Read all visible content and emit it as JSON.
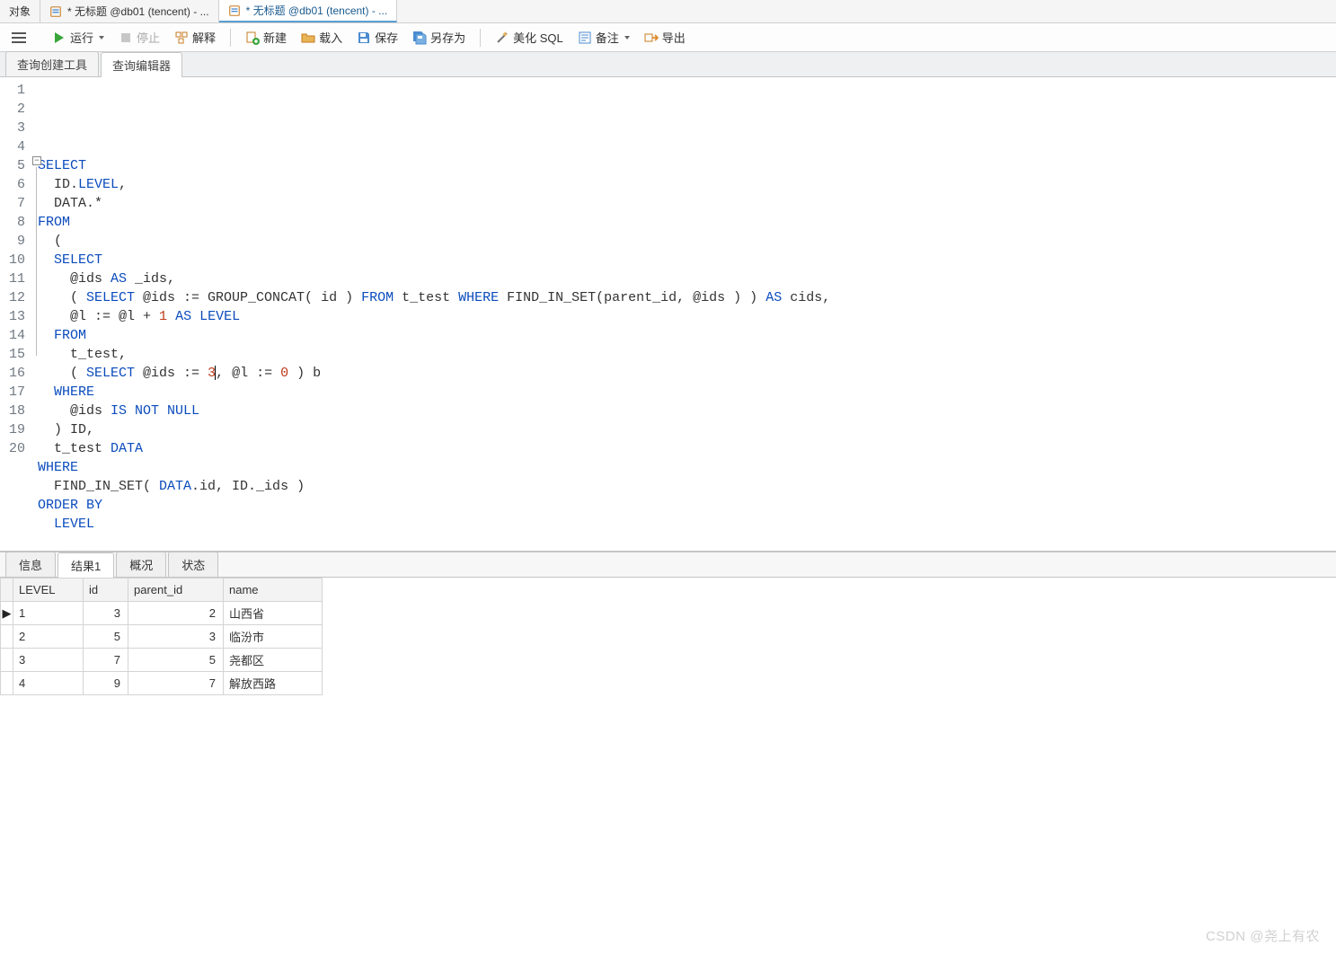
{
  "top_tabs": {
    "objects": "对象",
    "tab1": "* 无标题 @db01 (tencent) - ...",
    "tab2": "* 无标题 @db01 (tencent) - ..."
  },
  "toolbar": {
    "run": "运行",
    "stop": "停止",
    "explain": "解释",
    "new": "新建",
    "load": "载入",
    "save": "保存",
    "saveAs": "另存为",
    "beautify": "美化 SQL",
    "note": "备注",
    "export": "导出"
  },
  "sub_tabs": {
    "builder": "查询创建工具",
    "editor": "查询编辑器"
  },
  "editor": {
    "line_count": 20,
    "tokens": [
      [
        [
          "SELECT",
          "kw"
        ]
      ],
      [
        [
          "  ID",
          "ident"
        ],
        [
          ".",
          "ident"
        ],
        [
          "LEVEL",
          "kw"
        ],
        [
          ",",
          "ident"
        ]
      ],
      [
        [
          "  DATA",
          "ident"
        ],
        [
          ".*",
          "ident"
        ]
      ],
      [
        [
          "FROM",
          "kw"
        ]
      ],
      [
        [
          "  (",
          "ident"
        ]
      ],
      [
        [
          "  SELECT",
          "kw"
        ]
      ],
      [
        [
          "    @ids ",
          "ident"
        ],
        [
          "AS",
          "kw"
        ],
        [
          " _ids,",
          "ident"
        ]
      ],
      [
        [
          "    ( ",
          "ident"
        ],
        [
          "SELECT",
          "kw"
        ],
        [
          " @ids := GROUP_CONCAT( id ) ",
          "ident"
        ],
        [
          "FROM",
          "kw"
        ],
        [
          " t_test ",
          "ident"
        ],
        [
          "WHERE",
          "kw"
        ],
        [
          " FIND_IN_SET(parent_id, @ids ) ) ",
          "ident"
        ],
        [
          "AS",
          "kw"
        ],
        [
          " cids,",
          "ident"
        ]
      ],
      [
        [
          "    @l := @l + ",
          "ident"
        ],
        [
          "1",
          "num"
        ],
        [
          " ",
          "ident"
        ],
        [
          "AS",
          "kw"
        ],
        [
          " ",
          "ident"
        ],
        [
          "LEVEL",
          "kw"
        ]
      ],
      [
        [
          "  FROM",
          "kw"
        ]
      ],
      [
        [
          "    t_test,",
          "ident"
        ]
      ],
      [
        [
          "    ( ",
          "ident"
        ],
        [
          "SELECT",
          "kw"
        ],
        [
          " @ids := ",
          "ident"
        ],
        [
          "3",
          "num"
        ],
        [
          ", @l := ",
          "ident"
        ],
        [
          "0",
          "num"
        ],
        [
          " ) b",
          "ident"
        ]
      ],
      [
        [
          "  WHERE",
          "kw"
        ]
      ],
      [
        [
          "    @ids ",
          "ident"
        ],
        [
          "IS NOT NULL",
          "kw"
        ]
      ],
      [
        [
          "  ) ID,",
          "ident"
        ]
      ],
      [
        [
          "  t_test ",
          "ident"
        ],
        [
          "DATA",
          "kw"
        ]
      ],
      [
        [
          "WHERE",
          "kw"
        ]
      ],
      [
        [
          "  FIND_IN_SET( ",
          "ident"
        ],
        [
          "DATA",
          "kw"
        ],
        [
          ".id, ID._ids )",
          "ident"
        ]
      ],
      [
        [
          "ORDER BY",
          "kw"
        ]
      ],
      [
        [
          "  LEVEL",
          "kw"
        ]
      ]
    ]
  },
  "result_tabs": {
    "info": "信息",
    "result1": "结果1",
    "summary": "概况",
    "status": "状态"
  },
  "result_grid": {
    "columns": [
      "LEVEL",
      "id",
      "parent_id",
      "name"
    ],
    "rows": [
      {
        "LEVEL": "1",
        "id": "3",
        "parent_id": "2",
        "name": "山西省"
      },
      {
        "LEVEL": "2",
        "id": "5",
        "parent_id": "3",
        "name": "临汾市"
      },
      {
        "LEVEL": "3",
        "id": "7",
        "parent_id": "5",
        "name": "尧都区"
      },
      {
        "LEVEL": "4",
        "id": "9",
        "parent_id": "7",
        "name": "解放西路"
      }
    ]
  },
  "watermark": "CSDN @尧上有农"
}
